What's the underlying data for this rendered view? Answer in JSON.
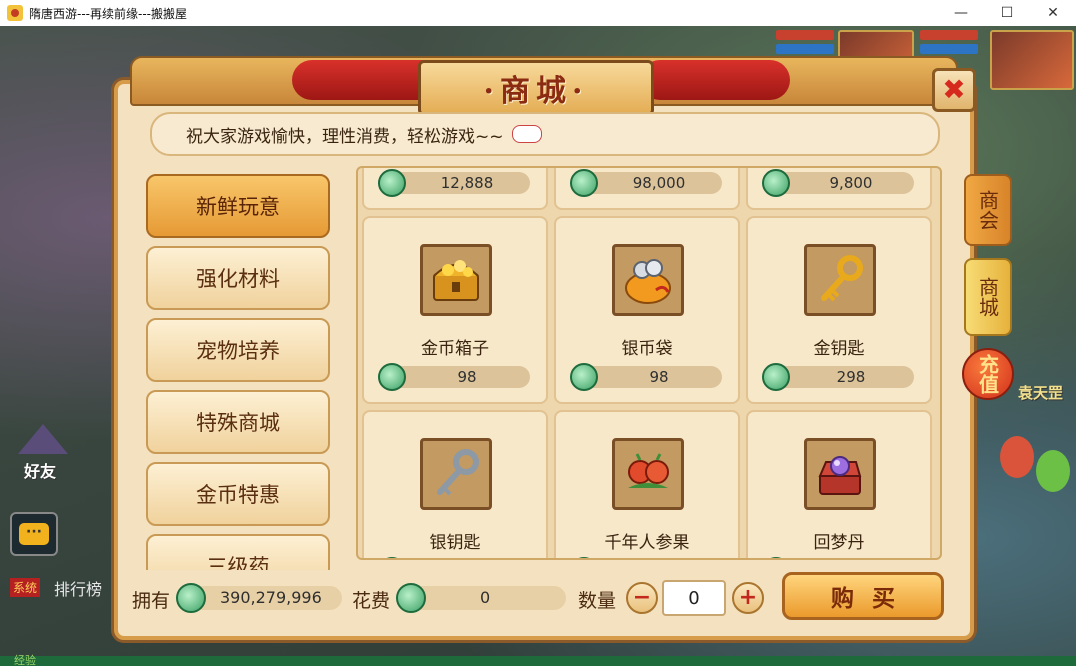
{
  "window": {
    "title": "隋唐西游---再续前缘---搬搬屋",
    "minimize_glyph": "—",
    "maximize_glyph": "☐",
    "close_glyph": "✕"
  },
  "hud": {
    "friend_label": "好友",
    "system_tag": "系统",
    "rank_label": "排行榜",
    "exp_label": "经验",
    "npc_name": "袁天罡",
    "chat_glyph": "···"
  },
  "shop": {
    "title": "·商城·",
    "close_glyph": "✖",
    "notice": "祝大家游戏愉快，理性消费，轻松游戏~~",
    "categories": [
      {
        "label": "新鲜玩意",
        "active": true
      },
      {
        "label": "强化材料",
        "active": false
      },
      {
        "label": "宠物培养",
        "active": false
      },
      {
        "label": "特殊商城",
        "active": false
      },
      {
        "label": "金币特惠",
        "active": false
      },
      {
        "label": "三级药",
        "active": false
      }
    ],
    "top_prices": [
      "12,888",
      "98,000",
      "9,800"
    ],
    "items": [
      {
        "name": "金币箱子",
        "price": "98",
        "icon": "gold-chest-icon"
      },
      {
        "name": "银币袋",
        "price": "98",
        "icon": "silver-coin-bag-icon"
      },
      {
        "name": "金钥匙",
        "price": "298",
        "icon": "gold-key-icon"
      },
      {
        "name": "银钥匙",
        "price": "",
        "icon": "silver-key-icon"
      },
      {
        "name": "千年人参果",
        "price": "",
        "icon": "ginseng-fruit-icon"
      },
      {
        "name": "回梦丹",
        "price": "",
        "icon": "dream-pill-box-icon"
      }
    ],
    "footer": {
      "own_label": "拥有",
      "own_value": "390,279,996",
      "cost_label": "花费",
      "cost_value": "0",
      "qty_label": "数量",
      "qty_value": "0",
      "minus_glyph": "−",
      "plus_glyph": "+",
      "buy_label": "购买"
    },
    "side_tabs": {
      "shop": "商会",
      "mall": "商城",
      "charge": "充值"
    }
  },
  "colors": {
    "panel_bg": "#f4e1bf",
    "active_tab": "#e69a35",
    "title_red": "#8a2b12",
    "coin_green": "#3aa063"
  }
}
